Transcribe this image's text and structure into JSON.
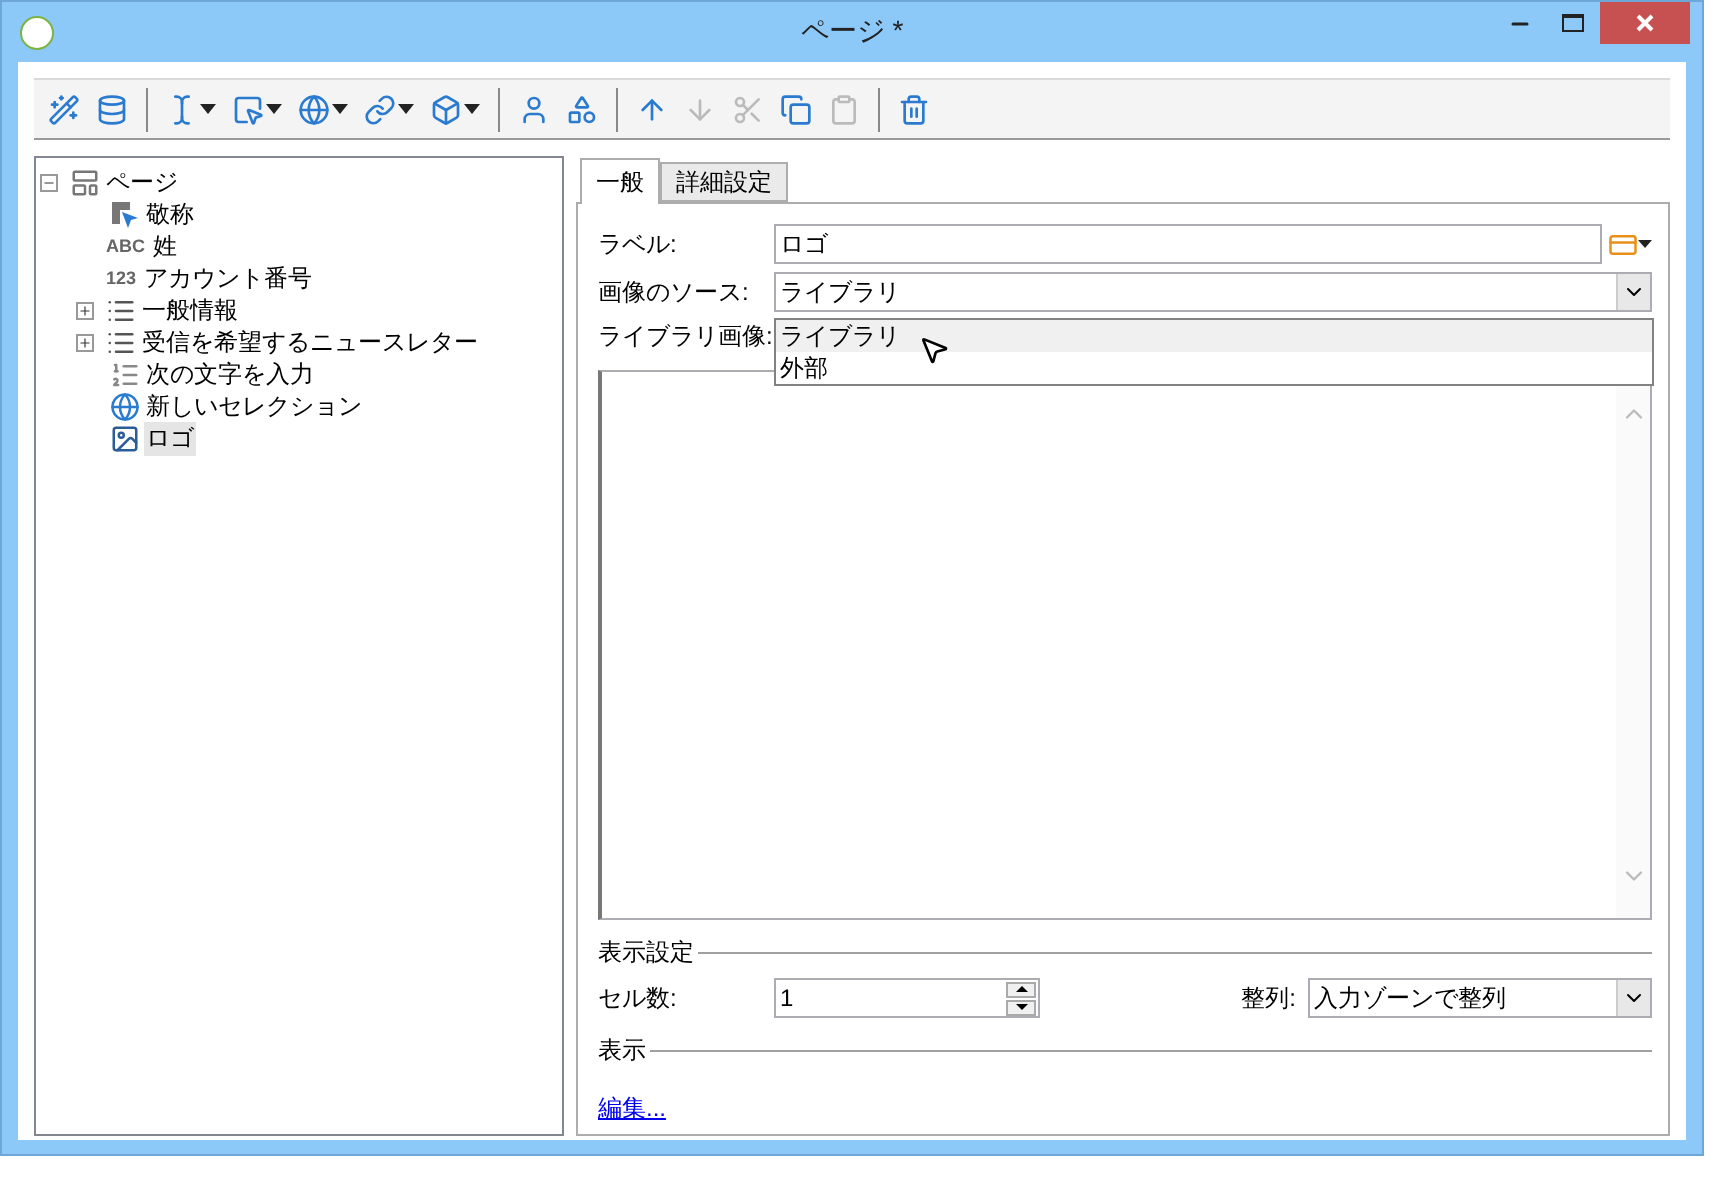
{
  "window": {
    "title": "ページ *"
  },
  "toolbar": [
    {
      "kind": "wand",
      "menu": false,
      "disabled": false
    },
    {
      "kind": "database",
      "menu": false,
      "disabled": false
    },
    {
      "kind": "separator"
    },
    {
      "kind": "text-cursor",
      "menu": true,
      "disabled": false
    },
    {
      "kind": "selector",
      "menu": true,
      "disabled": false
    },
    {
      "kind": "globe",
      "menu": true,
      "disabled": false
    },
    {
      "kind": "link",
      "menu": true,
      "disabled": false
    },
    {
      "kind": "box",
      "menu": true,
      "disabled": false
    },
    {
      "kind": "separator"
    },
    {
      "kind": "person",
      "menu": false,
      "disabled": false
    },
    {
      "kind": "shapes",
      "menu": false,
      "disabled": false
    },
    {
      "kind": "separator"
    },
    {
      "kind": "up",
      "menu": false,
      "disabled": false
    },
    {
      "kind": "down",
      "menu": false,
      "disabled": true
    },
    {
      "kind": "cut",
      "menu": false,
      "disabled": true
    },
    {
      "kind": "copy",
      "menu": false,
      "disabled": false
    },
    {
      "kind": "paste",
      "menu": false,
      "disabled": true
    },
    {
      "kind": "separator"
    },
    {
      "kind": "trash",
      "menu": false,
      "disabled": false
    }
  ],
  "tree": [
    {
      "label": "ページ",
      "kind": "page",
      "expanded": true,
      "selected": false,
      "children": [
        {
          "label": "敬称",
          "kind": "selector",
          "selected": false
        },
        {
          "label": "姓",
          "kind": "text",
          "badge": "ABC",
          "selected": false
        },
        {
          "label": "アカウント番号",
          "kind": "number",
          "badge": "123",
          "selected": false
        },
        {
          "label": "一般情報",
          "kind": "group",
          "expanded": false,
          "selected": false
        },
        {
          "label": "受信を希望するニュースレター",
          "kind": "group",
          "expanded": false,
          "selected": false
        },
        {
          "label": "次の文字を入力",
          "kind": "sequence",
          "selected": false
        },
        {
          "label": "新しいセレクション",
          "kind": "globe",
          "selected": false
        },
        {
          "label": "ロゴ",
          "kind": "image",
          "selected": true
        }
      ]
    }
  ],
  "tabs": [
    {
      "label": "一般",
      "selected": true
    },
    {
      "label": "詳細設定",
      "selected": false
    }
  ],
  "form": {
    "label": {
      "caption": "ラベル:",
      "value": "ロゴ"
    },
    "source": {
      "caption": "画像のソース:",
      "value": "ライブラリ",
      "options": [
        {
          "label": "ライブラリ",
          "selected": true
        },
        {
          "label": "外部",
          "selected": false
        }
      ]
    },
    "library_image": {
      "caption": "ライブラリ画像:"
    }
  },
  "display_settings": {
    "title": "表示設定",
    "cells": {
      "caption": "セル数:",
      "value": "1"
    },
    "align": {
      "caption": "整列:",
      "value": "入力ゾーンで整列"
    }
  },
  "display": {
    "title": "表示",
    "link": "編集..."
  }
}
